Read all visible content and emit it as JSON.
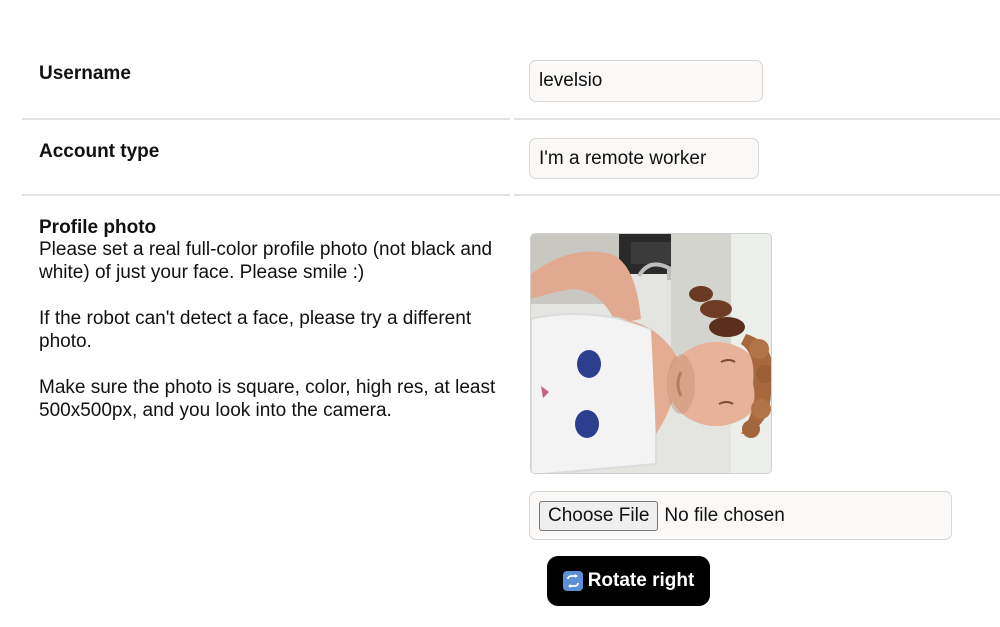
{
  "form": {
    "username": {
      "label": "Username",
      "value": "levelsio"
    },
    "account_type": {
      "label": "Account type",
      "value": "I'm a remote worker"
    },
    "profile_photo": {
      "label": "Profile photo",
      "description": [
        "Please set a real full-color profile photo (not black and white) of just your face. Please smile :)",
        "If the robot can't detect a face, please try a different photo.",
        "Make sure the photo is square, color, high res, at least 500x500px, and you look into the camera."
      ],
      "file_button_label": "Choose File",
      "file_status": "No file chosen",
      "rotate_button_label": "Rotate right",
      "rotate_icon": "clockwise-arrows-icon"
    }
  },
  "colors": {
    "divider": "#e2e2e2",
    "field_bg": "#faf9f7",
    "field_border": "#d8d6d2",
    "rotate_button_bg": "#000000",
    "rotate_icon_bg": "#5b8fd6"
  }
}
